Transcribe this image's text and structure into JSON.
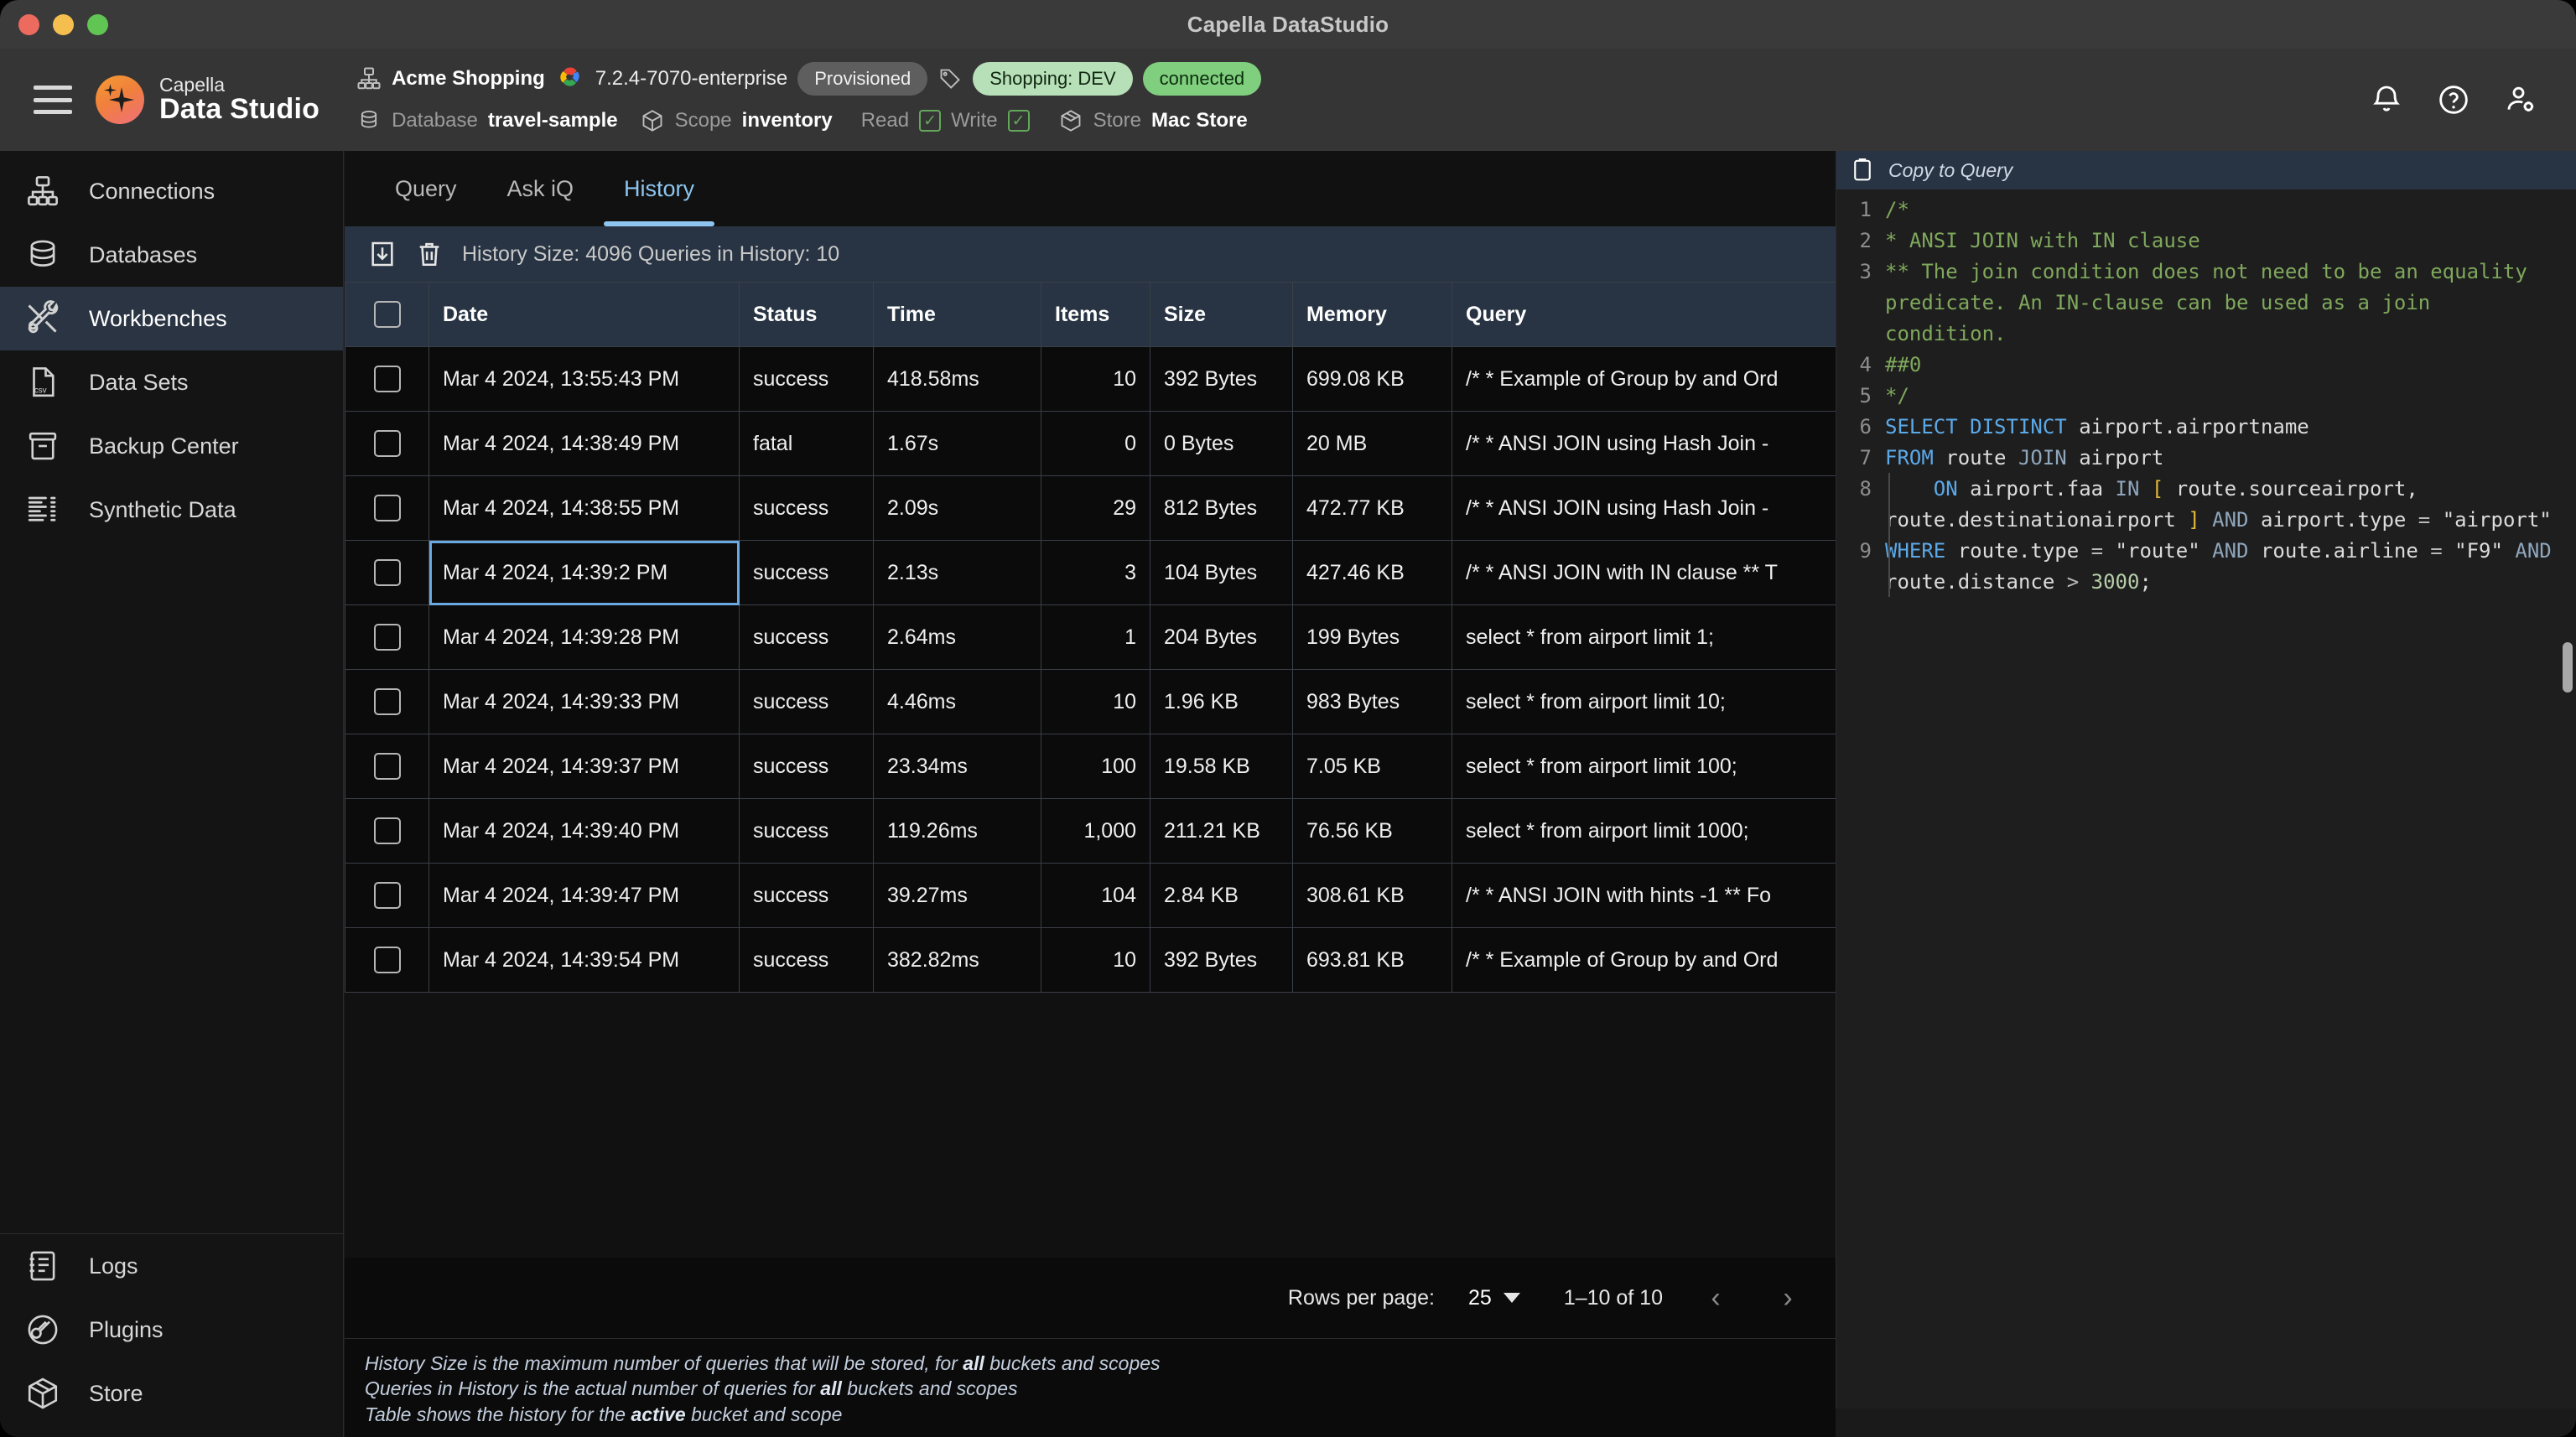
{
  "window": {
    "title": "Capella DataStudio"
  },
  "header": {
    "brand": {
      "line1": "Capella",
      "line2": "Data Studio",
      "icon": "capella-sparkle-logo"
    },
    "menu_icon": "hamburger-menu-icon",
    "cluster_name": "Acme Shopping",
    "cluster_icon": "cluster-topology-icon",
    "version": "7.2.4-7070-enterprise",
    "provider_icon": "google-cloud-icon",
    "provisioned_badge": "Provisioned",
    "tag_icon": "tag-icon",
    "bucket_badge": "Shopping: DEV",
    "connection_badge": "connected",
    "database_label": "Database",
    "database_value": "travel-sample",
    "database_icon": "database-icon",
    "scope_label": "Scope",
    "scope_value": "inventory",
    "scope_icon": "scope-cube-icon",
    "read_label": "Read",
    "read_checked": "✓",
    "write_label": "Write",
    "write_checked": "✓",
    "store_label": "Store",
    "store_value": "Mac Store",
    "store_icon": "store-box-icon",
    "notifications_icon": "bell-icon",
    "help_icon": "question-circle-icon",
    "account_icon": "user-settings-icon",
    "accent_blue": "#8ec5f0",
    "badge_green": "#7fcf7f",
    "badge_lightgreen": "#b7e0b9"
  },
  "sidebar": {
    "top_items": [
      {
        "label": "Connections",
        "icon": "connections-icon",
        "active": false
      },
      {
        "label": "Databases",
        "icon": "database-icon",
        "active": false
      },
      {
        "label": "Workbenches",
        "icon": "tools-icon",
        "active": true
      },
      {
        "label": "Data Sets",
        "icon": "csv-file-icon",
        "active": false
      },
      {
        "label": "Backup Center",
        "icon": "archive-box-icon",
        "active": false
      },
      {
        "label": "Synthetic Data",
        "icon": "synthetic-data-icon",
        "active": false
      }
    ],
    "bottom_items": [
      {
        "label": "Logs",
        "icon": "logs-icon",
        "active": false
      },
      {
        "label": "Plugins",
        "icon": "plug-icon",
        "active": false
      },
      {
        "label": "Store",
        "icon": "package-icon",
        "active": false
      }
    ]
  },
  "workbench": {
    "tabs": [
      {
        "label": "Query",
        "active": false
      },
      {
        "label": "Ask iQ",
        "active": false
      },
      {
        "label": "History",
        "active": true
      }
    ],
    "toolbar": {
      "download_icon": "download-icon",
      "delete_icon": "trash-icon",
      "status_text": "History Size: 4096 Queries in History: 10"
    },
    "table": {
      "select_all_checkbox": "checkbox",
      "columns": [
        "",
        "Date",
        "Status",
        "Time",
        "Items",
        "Size",
        "Memory",
        "Query"
      ],
      "rows": [
        {
          "date": "Mar 4 2024, 13:55:43 PM",
          "status": "success",
          "time": "418.58ms",
          "items": "10",
          "size": "392 Bytes",
          "memory": "699.08 KB",
          "query": "/* * Example of Group by and Ord",
          "focused": false
        },
        {
          "date": "Mar 4 2024, 14:38:49 PM",
          "status": "fatal",
          "time": "1.67s",
          "items": "0",
          "size": "0 Bytes",
          "memory": "20 MB",
          "query": "/* * ANSI JOIN using Hash Join -",
          "focused": false
        },
        {
          "date": "Mar 4 2024, 14:38:55 PM",
          "status": "success",
          "time": "2.09s",
          "items": "29",
          "size": "812 Bytes",
          "memory": "472.77 KB",
          "query": "/* * ANSI JOIN using Hash Join -",
          "focused": false
        },
        {
          "date": "Mar 4 2024, 14:39:2 PM",
          "status": "success",
          "time": "2.13s",
          "items": "3",
          "size": "104 Bytes",
          "memory": "427.46 KB",
          "query": "/* * ANSI JOIN with IN clause ** T",
          "focused": true
        },
        {
          "date": "Mar 4 2024, 14:39:28 PM",
          "status": "success",
          "time": "2.64ms",
          "items": "1",
          "size": "204 Bytes",
          "memory": "199 Bytes",
          "query": "select * from airport limit 1;",
          "focused": false
        },
        {
          "date": "Mar 4 2024, 14:39:33 PM",
          "status": "success",
          "time": "4.46ms",
          "items": "10",
          "size": "1.96 KB",
          "memory": "983 Bytes",
          "query": "select * from airport limit 10;",
          "focused": false
        },
        {
          "date": "Mar 4 2024, 14:39:37 PM",
          "status": "success",
          "time": "23.34ms",
          "items": "100",
          "size": "19.58 KB",
          "memory": "7.05 KB",
          "query": "select * from airport limit 100;",
          "focused": false
        },
        {
          "date": "Mar 4 2024, 14:39:40 PM",
          "status": "success",
          "time": "119.26ms",
          "items": "1,000",
          "size": "211.21 KB",
          "memory": "76.56 KB",
          "query": "select * from airport limit 1000;",
          "focused": false
        },
        {
          "date": "Mar 4 2024, 14:39:47 PM",
          "status": "success",
          "time": "39.27ms",
          "items": "104",
          "size": "2.84 KB",
          "memory": "308.61 KB",
          "query": "/* * ANSI JOIN with hints -1 ** Fo",
          "focused": false
        },
        {
          "date": "Mar 4 2024, 14:39:54 PM",
          "status": "success",
          "time": "382.82ms",
          "items": "10",
          "size": "392 Bytes",
          "memory": "693.81 KB",
          "query": "/* * Example of Group by and Ord",
          "focused": false
        }
      ]
    },
    "pagination": {
      "rows_per_page_label": "Rows per page:",
      "rows_per_page_value": "25",
      "caret_icon": "chevron-down-icon",
      "range": "1–10 of 10",
      "prev_icon": "‹",
      "next_icon": "›"
    },
    "notes": [
      {
        "pre": "History Size is the maximum number of queries that will be stored, for ",
        "bold": "all",
        "post": " buckets and scopes"
      },
      {
        "pre": "Queries in History is the actual number of queries for ",
        "bold": "all",
        "post": " buckets and scopes"
      },
      {
        "pre": "Table shows the history for the ",
        "bold": "active",
        "post": " bucket and scope"
      }
    ]
  },
  "code_panel": {
    "header": {
      "title": "Copy to Query",
      "icon": "clipboard-copy-icon"
    },
    "lines": [
      {
        "num": "1",
        "segments": [
          {
            "t": "/*",
            "c": "cm"
          }
        ]
      },
      {
        "num": "2",
        "segments": [
          {
            "t": "* ANSI JOIN with IN clause",
            "c": "cm"
          }
        ]
      },
      {
        "num": "3",
        "segments": [
          {
            "t": "** The join condition does not need to be an equality predicate. An IN-clause can be used as a join condition.",
            "c": "cm"
          }
        ]
      },
      {
        "num": "4",
        "segments": [
          {
            "t": "##0",
            "c": "cm"
          }
        ]
      },
      {
        "num": "5",
        "segments": [
          {
            "t": "*/",
            "c": "cm"
          }
        ]
      },
      {
        "num": "6",
        "segments": [
          {
            "t": "SELECT DISTINCT",
            "c": "kw"
          },
          {
            "t": " airport.airportname",
            "c": "id"
          }
        ]
      },
      {
        "num": "7",
        "segments": [
          {
            "t": "FROM",
            "c": "kw"
          },
          {
            "t": " route ",
            "c": "id"
          },
          {
            "t": "JOIN",
            "c": "kw2"
          },
          {
            "t": " airport",
            "c": "id"
          }
        ]
      },
      {
        "num": "8",
        "segments": [
          {
            "t": "    ",
            "c": "id"
          },
          {
            "t": "ON",
            "c": "kw"
          },
          {
            "t": " airport.faa ",
            "c": "id"
          },
          {
            "t": "IN",
            "c": "kw2"
          },
          {
            "t": " ",
            "c": "id"
          },
          {
            "t": "[",
            "c": "br"
          },
          {
            "t": " route.sourceairport, route.destinationairport ",
            "c": "id"
          },
          {
            "t": "]",
            "c": "br"
          },
          {
            "t": " ",
            "c": "id"
          },
          {
            "t": "AND",
            "c": "kw2"
          },
          {
            "t": " airport.type ",
            "c": "id"
          },
          {
            "t": "=",
            "c": "op"
          },
          {
            "t": " \"airport\"",
            "c": "id"
          }
        ]
      },
      {
        "num": "9",
        "segments": [
          {
            "t": "WHERE",
            "c": "kw"
          },
          {
            "t": " route.type ",
            "c": "id"
          },
          {
            "t": "=",
            "c": "op"
          },
          {
            "t": " \"route\" ",
            "c": "id"
          },
          {
            "t": "AND",
            "c": "kw2"
          },
          {
            "t": " route.airline ",
            "c": "id"
          },
          {
            "t": "=",
            "c": "op"
          },
          {
            "t": " \"F9\" ",
            "c": "id"
          },
          {
            "t": "AND",
            "c": "kw2"
          },
          {
            "t": " route.distance ",
            "c": "id"
          },
          {
            "t": ">",
            "c": "op"
          },
          {
            "t": " ",
            "c": "id"
          },
          {
            "t": "3000",
            "c": "num"
          },
          {
            "t": ";",
            "c": "id"
          }
        ]
      }
    ]
  }
}
